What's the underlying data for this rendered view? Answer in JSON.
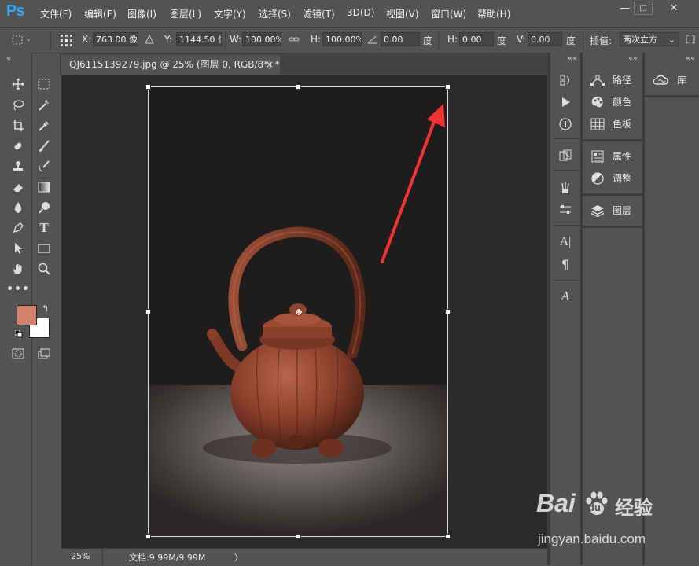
{
  "app": {
    "logo": "Ps"
  },
  "menu": [
    "文件(F)",
    "编辑(E)",
    "图像(I)",
    "图层(L)",
    "文字(Y)",
    "选择(S)",
    "滤镜(T)",
    "3D(D)",
    "视图(V)",
    "窗口(W)",
    "帮助(H)"
  ],
  "window_controls": {
    "minimize": "—",
    "maximize": "□",
    "close": "✕"
  },
  "options": {
    "x_label": "X:",
    "x_value": "763.00 像素",
    "y_label": "Y:",
    "y_value": "1144.50 像",
    "w_label": "W:",
    "w_value": "100.00%",
    "h_label": "H:",
    "h_value": "100.00%",
    "angle_value": "0.00",
    "angle_unit": "度",
    "hskew_label": "H:",
    "hskew_value": "0.00",
    "hskew_unit": "度",
    "vskew_label": "V:",
    "vskew_value": "0.00",
    "vskew_unit": "度",
    "interp_label": "插值:",
    "interp_value": "两次立方"
  },
  "document": {
    "tab_title": "QJ6115139279.jpg @ 25% (图层 0, RGB/8*) *",
    "tab_close": "×"
  },
  "status": {
    "zoom": "25%",
    "doc_info": "文档:9.99M/9.99M",
    "arrow": "〉"
  },
  "panels": {
    "group1": [
      {
        "label": "路径",
        "icon": "paths-icon"
      },
      {
        "label": "颜色",
        "icon": "color-palette-icon"
      },
      {
        "label": "色板",
        "icon": "swatches-icon"
      }
    ],
    "group2": [
      {
        "label": "属性",
        "icon": "properties-icon"
      },
      {
        "label": "调整",
        "icon": "adjustments-icon"
      }
    ],
    "group3": [
      {
        "label": "图层",
        "icon": "layers-icon"
      }
    ],
    "library": {
      "label": "库",
      "icon": "creative-cloud-icon"
    }
  },
  "colors": {
    "foreground": "#d4826a",
    "background": "#ffffff",
    "arrow": "#ee3333"
  },
  "watermark": {
    "brand": "Bai",
    "brand_cn": "经验",
    "url": "jingyan.baidu.com"
  }
}
